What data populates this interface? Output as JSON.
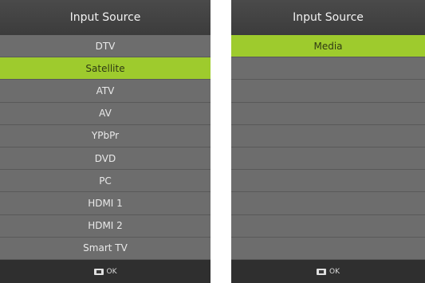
{
  "left_panel": {
    "title": "Input Source",
    "items": [
      "DTV",
      "Satellite",
      "ATV",
      "AV",
      "YPbPr",
      "DVD",
      "PC",
      "HDMI 1",
      "HDMI 2",
      "Smart TV"
    ],
    "selected_index": 1,
    "footer_label": "OK"
  },
  "right_panel": {
    "title": "Input Source",
    "items": [
      "Media"
    ],
    "selected_index": 0,
    "footer_label": "OK"
  },
  "colors": {
    "selected": "#9ecb2d",
    "background": "#6d6d6d",
    "header": "#3c3c3c",
    "footer": "#2f2f2f"
  }
}
